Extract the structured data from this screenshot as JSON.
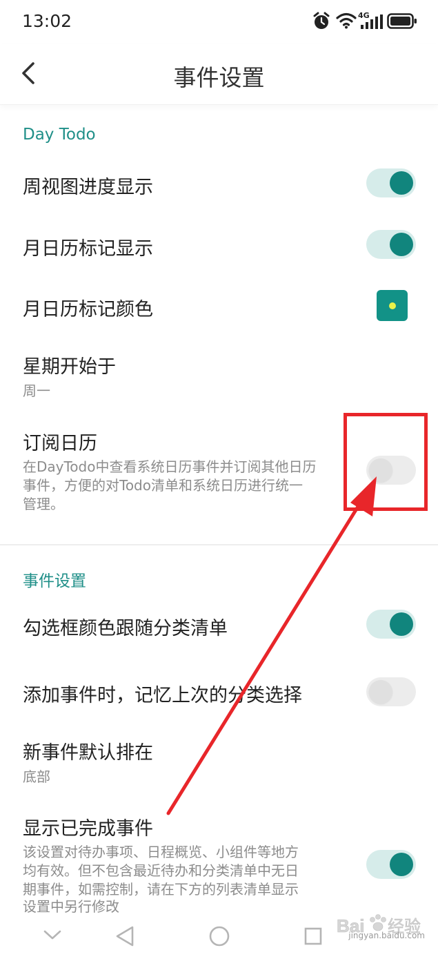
{
  "status_bar": {
    "time": "13:02",
    "network_label": "4G",
    "icons": [
      "alarm-icon",
      "wifi-icon",
      "signal-icon",
      "battery-icon"
    ]
  },
  "header": {
    "title": "事件设置",
    "back_icon": "chevron-left-icon"
  },
  "sections": {
    "day_todo": {
      "heading": "Day Todo",
      "week_progress": {
        "label": "周视图进度显示",
        "enabled": true
      },
      "month_mark_show": {
        "label": "月日历标记显示",
        "enabled": true
      },
      "month_mark_color": {
        "label": "月日历标记颜色",
        "color": "#129287",
        "dot_color": "#e7f24a"
      },
      "week_start": {
        "label": "星期开始于",
        "value": "周一"
      },
      "subscribe_calendar": {
        "label": "订阅日历",
        "description_line1": "在DayTodo中查看系统日历事件并订阅其他日历",
        "description_line2": "事件，方便的对Todo清单和系统日历进行统一",
        "description_line3": "管理。",
        "enabled": false
      }
    },
    "event_settings": {
      "heading": "事件设置",
      "checkbox_color": {
        "label": "勾选框颜色跟随分类清单",
        "enabled": true
      },
      "remember_category": {
        "label": "添加事件时，记忆上次的分类选择",
        "enabled": false
      },
      "default_position": {
        "label": "新事件默认排在",
        "value": "底部"
      },
      "show_completed": {
        "label": "显示已完成事件",
        "description_line1": "该设置对待办事项、日程概览、小组件等地方",
        "description_line2": "均有效。但不包含最近待办和分类清单中无日",
        "description_line3": "期事件，如需控制，请在下方的列表清单显示",
        "description_line4": "设置中另行修改",
        "enabled": true
      }
    }
  },
  "colors": {
    "accent": "#11857d",
    "toggle_on_track": "#d6ecea",
    "toggle_off_track": "#ececec",
    "annotation": "#e8262a"
  },
  "nav_bar": {
    "icons": [
      "chevron-down-icon",
      "back-triangle-icon",
      "home-circle-icon",
      "recents-square-icon"
    ]
  },
  "watermark": {
    "brand": "Bai 经验",
    "url": "jingyan.baidu.com"
  }
}
